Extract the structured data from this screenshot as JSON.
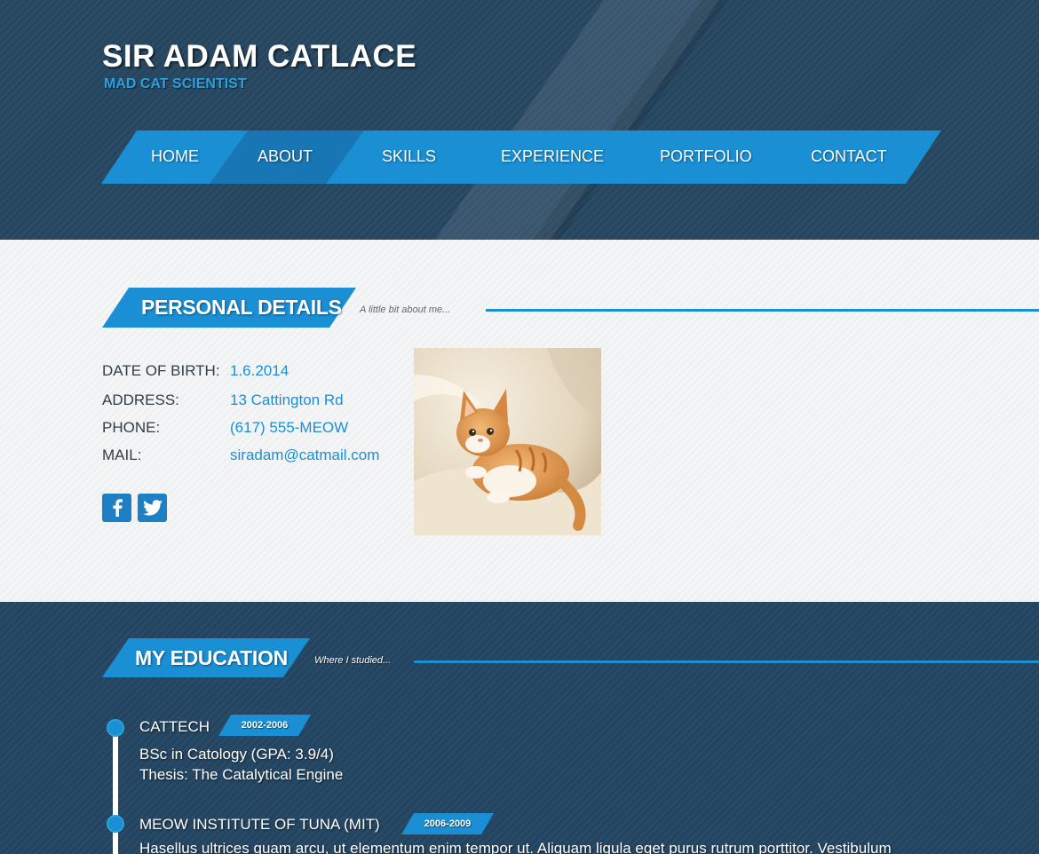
{
  "header": {
    "name": "SIR ADAM CATLACE",
    "job_title": "MAD CAT SCIENTIST"
  },
  "nav": {
    "items": [
      {
        "label": "HOME"
      },
      {
        "label": "ABOUT",
        "active": true
      },
      {
        "label": "SKILLS"
      },
      {
        "label": "EXPERIENCE"
      },
      {
        "label": "PORTFOLIO"
      },
      {
        "label": "CONTACT"
      }
    ]
  },
  "personal": {
    "title": "PERSONAL DETAILS",
    "subtitle": "A little bit about me...",
    "details": [
      {
        "label": "DATE OF BIRTH:",
        "value": "1.6.2014"
      },
      {
        "label": "ADDRESS:",
        "value": "13 Cattington Rd"
      },
      {
        "label": "PHONE:",
        "value": "(617) 555-MEOW"
      },
      {
        "label": "MAIL:",
        "value": "siradam@catmail.com"
      }
    ],
    "social": [
      {
        "icon": "facebook-icon"
      },
      {
        "icon": "twitter-icon"
      }
    ]
  },
  "education": {
    "title": "MY EDUCATION",
    "subtitle": "Where I studied...",
    "entries": [
      {
        "school": "CATTECH",
        "years": "2002-2006",
        "lines": [
          "BSc in Catology (GPA: 3.9/4)",
          "Thesis: The Catalytical Engine"
        ]
      },
      {
        "school": "MEOW INSTITUTE OF TUNA (MIT)",
        "years": "2006-2009",
        "lines": [
          "Hasellus ultrices quam arcu, ut elementum enim tempor ut. Aliquam ligula eget purus rutrum porttitor. Vestibulum"
        ]
      }
    ]
  },
  "colors": {
    "accent": "#1b8fd4",
    "header_bg": "#264660",
    "light_bg": "#f3f5f6"
  }
}
